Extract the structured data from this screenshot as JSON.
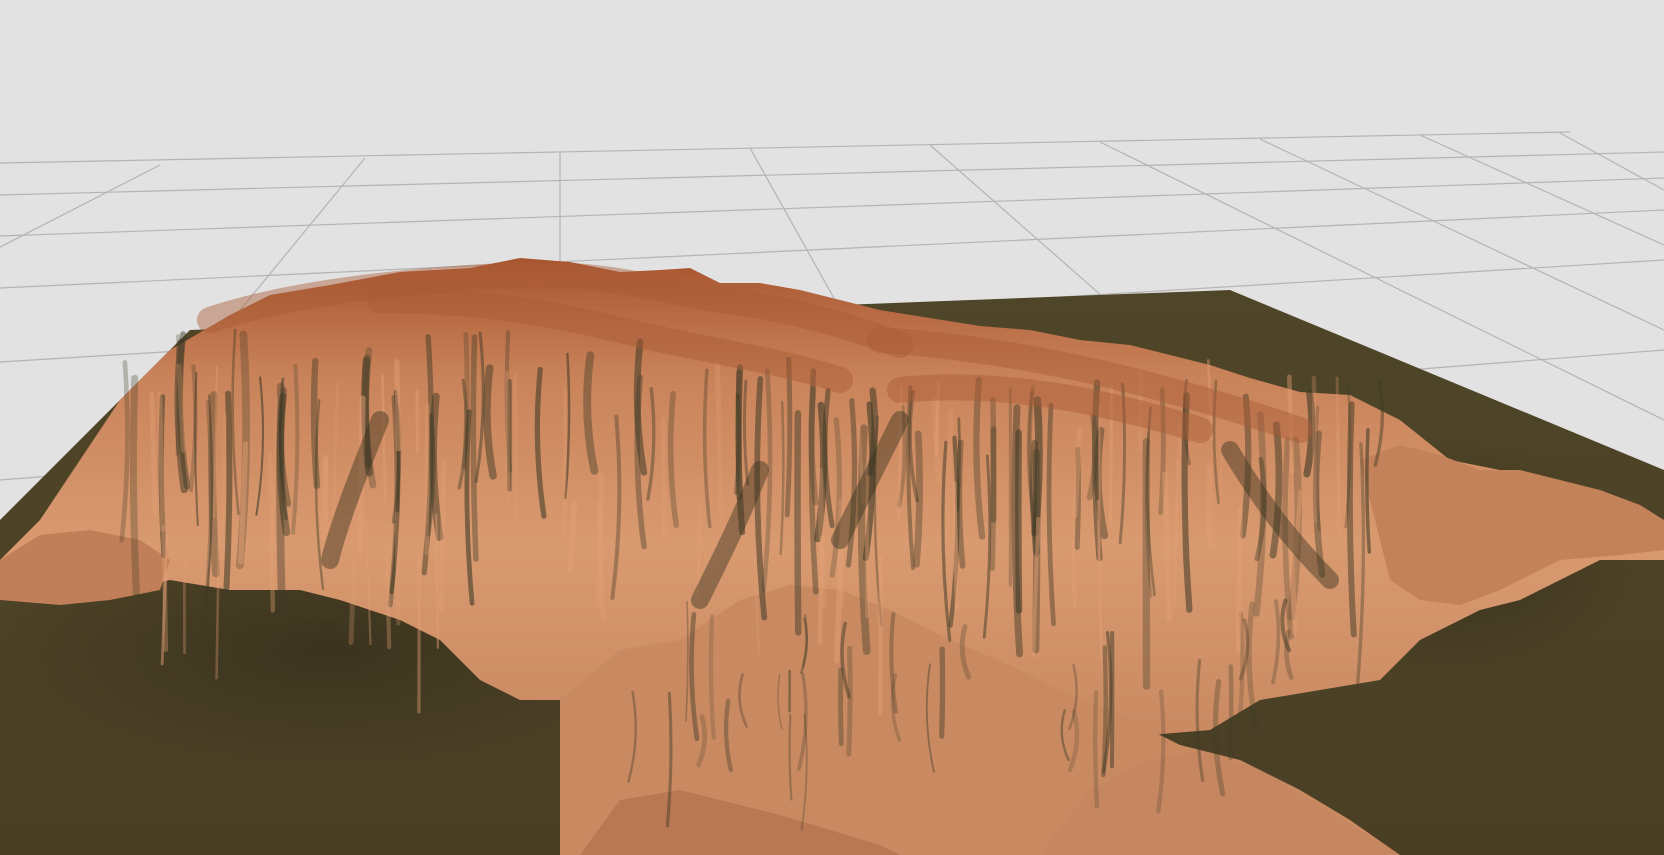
{
  "viewport": {
    "background_color": "#e2e2e2",
    "grid_line_color": "#b4b4b4",
    "grid_visible": true
  },
  "terrain": {
    "ground_color": "#4c4127",
    "ground_shadow_color": "#3a3220",
    "rock_light_color": "#e3a075",
    "rock_mid_color": "#c9845a",
    "rock_dark_color": "#7a4a2c",
    "rock_crest_color": "#a85a35",
    "crevice_color": "#3e3a26"
  }
}
